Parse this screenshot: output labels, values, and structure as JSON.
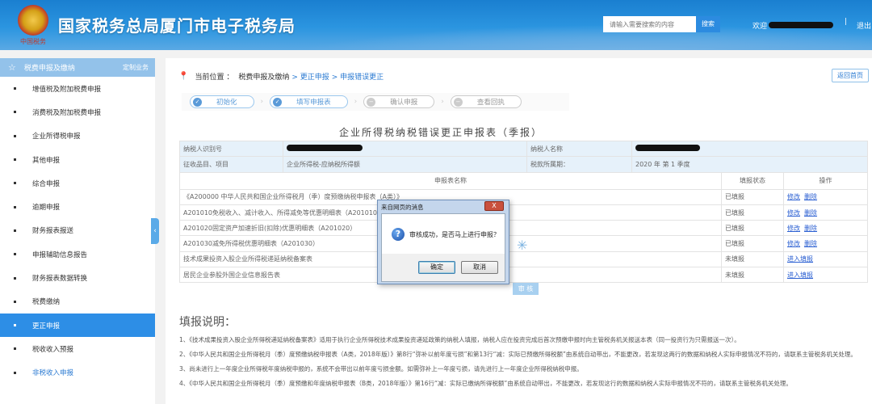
{
  "header": {
    "title": "国家税务总局厦门市电子税务局",
    "emblem_caption": "中国税务",
    "search_placeholder": "请输入需要搜索的内容",
    "search_button": "搜索",
    "welcome": "欢迎",
    "logout": "退出"
  },
  "sidebar": {
    "section": "税费申报及缴纳",
    "custom": "定制业务",
    "items": [
      {
        "label": "增值税及附加税费申报"
      },
      {
        "label": "消费税及附加税费申报"
      },
      {
        "label": "企业所得税申报"
      },
      {
        "label": "其他申报"
      },
      {
        "label": "综合申报"
      },
      {
        "label": "逾期申报"
      },
      {
        "label": "财务报表报送"
      },
      {
        "label": "申报辅助信息报告"
      },
      {
        "label": "财务报表数据转换"
      },
      {
        "label": "税费缴纳"
      },
      {
        "label": "更正申报",
        "active": true
      },
      {
        "label": "税收收入预报"
      },
      {
        "label": "非税收入申报"
      }
    ]
  },
  "breadcrumb": {
    "prefix": "当前位置 ：",
    "items": [
      "税费申报及缴纳",
      "> 更正申报",
      "> 申报错误更正"
    ]
  },
  "home_button": "返回首页",
  "steps": [
    {
      "label": "初始化",
      "status": "done"
    },
    {
      "label": "填写申报表",
      "status": "done"
    },
    {
      "label": "确认申报",
      "status": "pending"
    },
    {
      "label": "查看回执",
      "status": "pending"
    }
  ],
  "form": {
    "title": "企业所得税纳税错误更正申报表（季报）",
    "taxpayer_id_label": "纳税人识别号",
    "taxpayer_name_label": "纳税人名称",
    "item_label": "征收品目、项目",
    "item_value": "企业所得税-应纳税所得额",
    "period_label": "税款所属期：",
    "period_value": "2020 年 第 1 季度",
    "columns": [
      "申报表名称",
      "填报状态",
      "操作"
    ],
    "rows": [
      {
        "name": "《A200000 中华人民共和国企业所得税月（季）度预缴纳税申报表（A类）》",
        "status": "已填报",
        "actions": [
          "修改",
          "删除"
        ]
      },
      {
        "name": "A201010免税收入、减计收入、所得减免等优惠明细表（A201010）",
        "status": "已填报",
        "actions": [
          "修改",
          "删除"
        ]
      },
      {
        "name": "A201020固定资产加速折旧(扣除)优惠明细表（A201020）",
        "status": "已填报",
        "actions": [
          "修改",
          "删除"
        ]
      },
      {
        "name": "A201030减免所得税优惠明细表（A201030）",
        "status": "已填报",
        "actions": [
          "修改",
          "删除"
        ]
      },
      {
        "name": "技术成果投资入股企业所得税递延纳税备案表",
        "status": "未填报",
        "actions": [
          "进入填报"
        ]
      },
      {
        "name": "居民企业参股外国企业信息报告表",
        "status": "未填报",
        "actions": [
          "进入填报"
        ]
      }
    ],
    "audit_button": "审 核"
  },
  "notes": {
    "title": "填报说明：",
    "items": [
      "1、《技术成果投资入股企业所得税递延纳税备案表》适用于执行企业所得税技术成果投资递延政策的纳税人填报，纳税人应在投资完成后首次预缴申报时向主管税务机关报送本表（同一投资行为只需报送一次）。",
      "2、《中华人民共和国企业所得税月（季）度预缴纳税申报表（A类，2018年版）》第8行“弥补以前年度亏损”和第13行“减：实际已预缴所得税额”由系统自动带出，不能更改，若发现这两行的数据和纳税人实际申报情况不符的，请联系主管税务机关处理。",
      "3、尚未进行上一年度企业所得税年度纳税申报的，系统不会带出以前年度亏损金额。如需弥补上一年度亏损，请先进行上一年度企业所得税纳税申报。",
      "4、《中华人民共和国企业所得税月（季）度预缴和年度纳税申报表（B类，2018年版）》第16行“减：实际已缴纳所得税额”由系统自动带出，不能更改，若发现这行的数据和纳税人实际申报情况不符的，请联系主管税务机关处理。"
    ]
  },
  "dialog": {
    "title": "来自网页的消息",
    "close": "X",
    "message": "审核成功，是否马上进行申报？",
    "ok": "确定",
    "cancel": "取消"
  }
}
